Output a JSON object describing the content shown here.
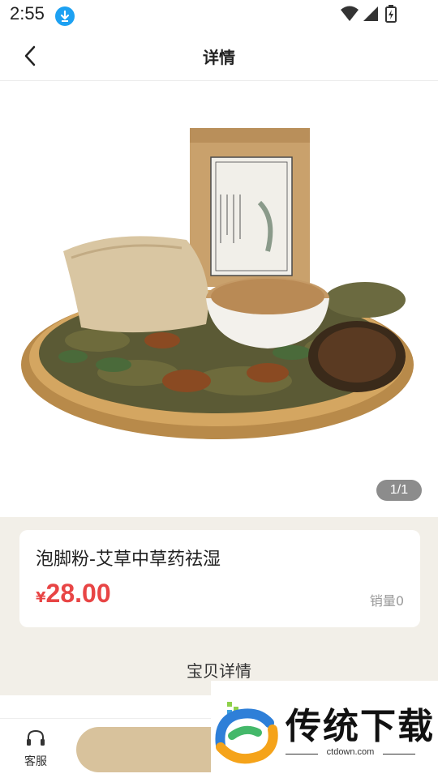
{
  "status_bar": {
    "time": "2:55",
    "icons": [
      "download-icon",
      "wifi-icon",
      "signal-icon",
      "battery-icon"
    ]
  },
  "header": {
    "title": "详情",
    "back_icon": "chevron-left-icon"
  },
  "gallery": {
    "image_description_icon": "product-photo",
    "page_indicator": "1/1"
  },
  "product": {
    "title": "泡脚粉-艾草中草药祛湿",
    "currency": "¥",
    "price": "28.00",
    "sales": "销量0"
  },
  "details": {
    "heading": "宝贝详情"
  },
  "bottom_bar": {
    "service_label": "客服",
    "service_icon": "headset-icon"
  },
  "watermark": {
    "name": "传统下载",
    "url": "ctdown.com"
  },
  "colors": {
    "accent_price": "#e84545",
    "buy_button": "#d8c29c",
    "info_bg": "#f2efe8",
    "indicator_bg": "#8c8c8c"
  }
}
